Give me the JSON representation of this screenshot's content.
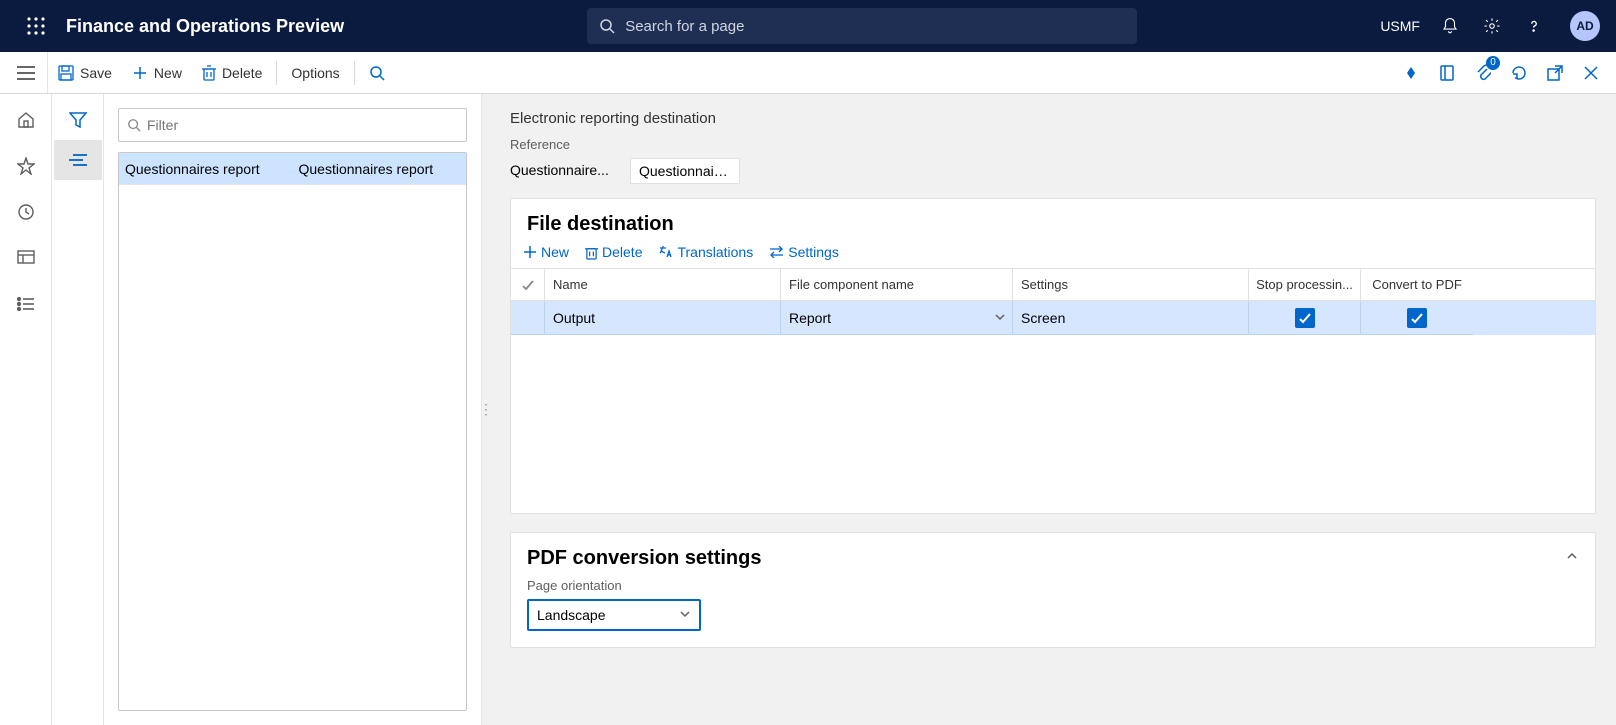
{
  "topnav": {
    "title": "Finance and Operations Preview",
    "search_placeholder": "Search for a page",
    "company": "USMF",
    "avatar": "AD",
    "badge": "0"
  },
  "actionbar": {
    "save": "Save",
    "new": "New",
    "delete": "Delete",
    "options": "Options"
  },
  "list": {
    "filter_placeholder": "Filter",
    "rows": [
      {
        "col1": "Questionnaires report",
        "col2": "Questionnaires report"
      }
    ]
  },
  "main": {
    "pagetitle": "Electronic reporting destination",
    "reference_label": "Reference",
    "reference_values": [
      "Questionnaire...",
      "Questionnaire..."
    ],
    "file_destination_title": "File destination",
    "toolbar": {
      "new": "New",
      "delete": "Delete",
      "translations": "Translations",
      "settings": "Settings"
    },
    "grid": {
      "headers": {
        "name": "Name",
        "file_component": "File component name",
        "settings": "Settings",
        "stop": "Stop processin...",
        "convert": "Convert to PDF"
      },
      "rows": [
        {
          "name": "Output",
          "file_component": "Report",
          "settings": "Screen",
          "stop": true,
          "convert": true
        }
      ]
    },
    "pdf_section_title": "PDF conversion settings",
    "page_orientation_label": "Page orientation",
    "page_orientation_value": "Landscape"
  }
}
